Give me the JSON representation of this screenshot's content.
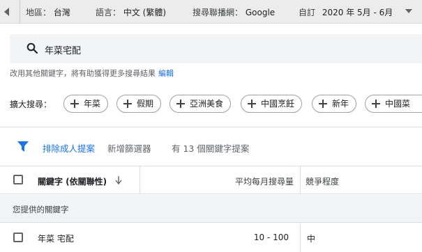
{
  "settings_bar": {
    "location_label": "地區：",
    "location_value": "台灣",
    "language_label": "語言：",
    "language_value": "中文 (繁體)",
    "network_label": "搜尋聯播網：",
    "network_value": "Google",
    "period_label": "自訂",
    "period_value": "2020 年 5月 - 6月"
  },
  "search": {
    "query": "年菜宅配"
  },
  "hint": {
    "text": "改用其他關鍵字，將有助獲得更多搜尋結果",
    "edit_link": "編輯"
  },
  "broaden": {
    "label": "擴大搜尋：",
    "chips": [
      "年菜",
      "假期",
      "亞洲美食",
      "中國烹飪",
      "新年",
      "中國菜"
    ]
  },
  "filters": {
    "adult_filter": "排除成人提案",
    "add_filter": "新增篩選器",
    "result_count": "有 13 個關鍵字提案"
  },
  "table": {
    "headers": {
      "keyword": "關鍵字 (依關聯性)",
      "avg_searches": "平均每月搜尋量",
      "competition": "競爭程度"
    },
    "group_label": "您提供的關鍵字",
    "rows": [
      {
        "keyword": "年菜 宅配",
        "avg_searches": "10 - 100",
        "competition": "中"
      }
    ]
  },
  "colors": {
    "accent": "#1a73e8",
    "topbar_bg": "#ececec",
    "search_bg": "#f1f3f4"
  },
  "icons": [
    "back-arrow-icon",
    "dropdown-caret-icon",
    "search-icon",
    "plus-icon",
    "filter-icon",
    "sort-down-arrow-icon",
    "checkbox-icon"
  ]
}
